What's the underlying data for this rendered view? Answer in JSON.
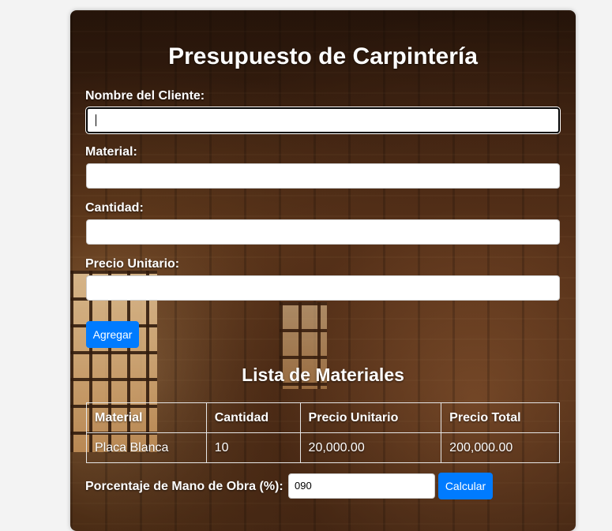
{
  "form": {
    "title": "Presupuesto de Carpintería",
    "client_label": "Nombre del Cliente:",
    "client_value": "",
    "material_label": "Material:",
    "material_value": "",
    "quantity_label": "Cantidad:",
    "quantity_value": "",
    "unit_price_label": "Precio Unitario:",
    "unit_price_value": "",
    "add_button": "Agregar"
  },
  "materials": {
    "title": "Lista de Materiales",
    "columns": [
      "Material",
      "Cantidad",
      "Precio Unitario",
      "Precio Total"
    ],
    "rows": [
      [
        "Placa Blanca",
        "10",
        "20,000.00",
        "200,000.00"
      ]
    ]
  },
  "labor": {
    "label": "Porcentaje de Mano de Obra (%):",
    "value": "090",
    "calc_button": "Calcular"
  },
  "colors": {
    "accent": "#007bff",
    "text": "#ffffff"
  }
}
